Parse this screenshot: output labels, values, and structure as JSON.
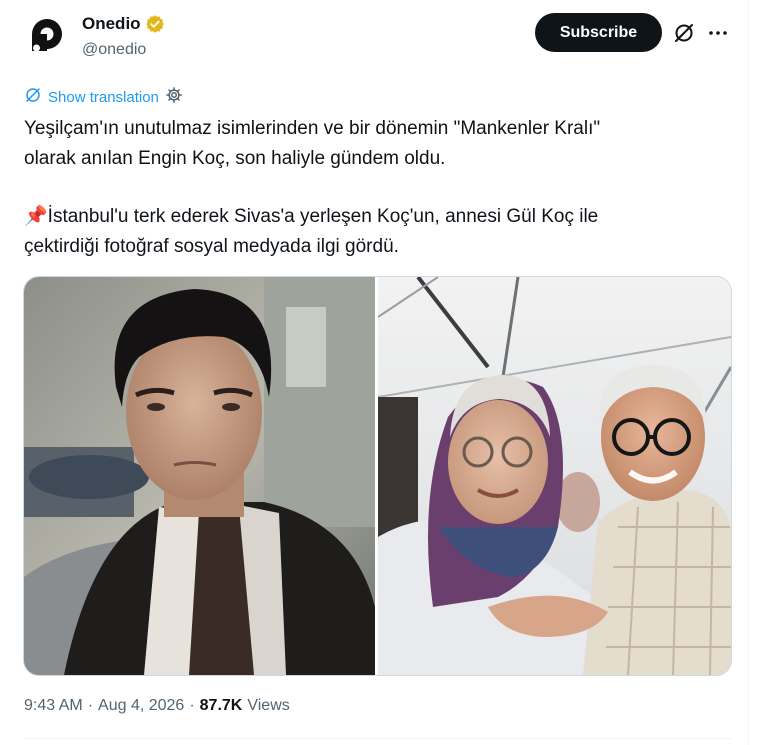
{
  "author": {
    "display_name": "Onedio",
    "handle": "@onedio",
    "avatar_icon": "onedio-logo-icon",
    "verified_icon": "gold-verified-badge-icon",
    "verified_color": "#e2b719"
  },
  "header": {
    "subscribe_label": "Subscribe",
    "grok_icon": "grok-icon",
    "more_icon": "more-dots-icon"
  },
  "translation": {
    "label": "Show translation",
    "icon": "translate-icon",
    "settings_icon": "gear-icon"
  },
  "tweet": {
    "paragraph_1_line_1": "Yeşilçam'ın unutulmaz isimlerinden ve bir dönemin \"Mankenler Kralı\"",
    "paragraph_1_line_2": "olarak anılan Engin Koç, son haliyle gündem oldu.",
    "pin_emoji": "📌",
    "paragraph_2_line_1": "İstanbul'u terk ederek Sivas'a yerleşen Koç'un, annesi Gül Koç ile",
    "paragraph_2_line_2": "çektirdiği fotoğraf sosyal medyada ilgi gördü."
  },
  "media": {
    "images": [
      {
        "semantic": "young-man-portrait-photo"
      },
      {
        "semantic": "elderly-mother-and-son-selfie-photo"
      }
    ]
  },
  "meta": {
    "time": "9:43 AM",
    "separator_1": "·",
    "date": "Aug 4, 2026",
    "separator_2": "·",
    "views_count": "87.7K",
    "views_label": "Views"
  },
  "colors": {
    "link": "#1d9bf0",
    "secondary_text": "#536471",
    "primary_text": "#0f1419",
    "subscribe_bg": "#0f1419"
  }
}
